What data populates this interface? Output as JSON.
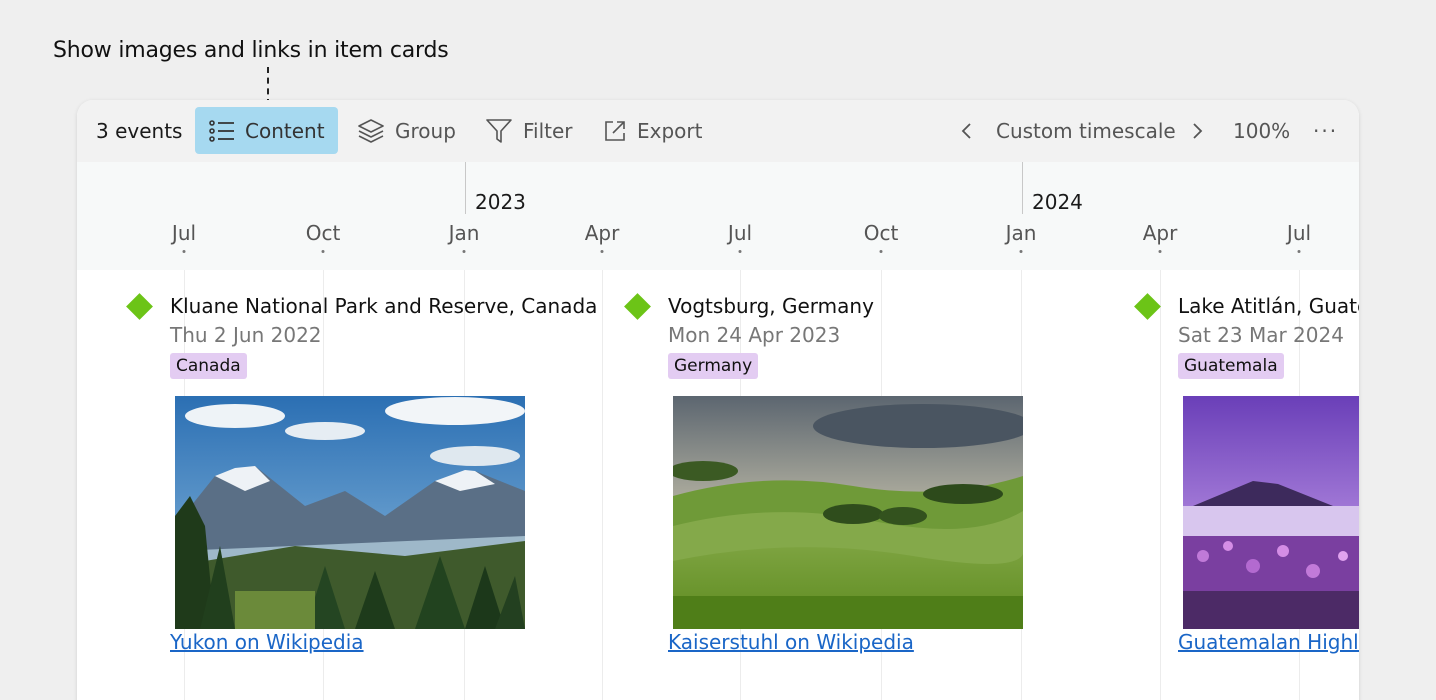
{
  "callout": {
    "text": "Show images and links in item cards"
  },
  "toolbar": {
    "events_count": "3 events",
    "content_label": "Content",
    "group_label": "Group",
    "filter_label": "Filter",
    "export_label": "Export",
    "timescale_label": "Custom timescale",
    "zoom": "100%",
    "more": "···"
  },
  "axis": {
    "years": [
      "2023",
      "2024"
    ],
    "ticks": [
      "Jul",
      "Oct",
      "Jan",
      "Apr",
      "Jul",
      "Oct",
      "Jan",
      "Apr",
      "Jul"
    ]
  },
  "events": [
    {
      "title": "Kluane National Park and Reserve, Canada",
      "date": "Thu 2 Jun 2022",
      "tag": "Canada",
      "link": "Yukon on Wikipedia"
    },
    {
      "title": "Vogtsburg, Germany",
      "date": "Mon 24 Apr 2023",
      "tag": "Germany",
      "link": "Kaiserstuhl on Wikipedia"
    },
    {
      "title": "Lake Atitlán, Guatemala",
      "date": "Sat 23 Mar 2024",
      "tag": "Guatemala",
      "link": "Guatemalan Highlands on Wikipedia"
    }
  ],
  "colors": {
    "accent": "#a6d9f0",
    "event_marker": "#6cc417",
    "tag_background": "#e3ccf2",
    "link": "#1a66c7"
  },
  "icons": {
    "content": "list-icon",
    "group": "layers-icon",
    "filter": "filter-icon",
    "export": "export-icon",
    "prev": "chevron-left-icon",
    "next": "chevron-right-icon"
  }
}
